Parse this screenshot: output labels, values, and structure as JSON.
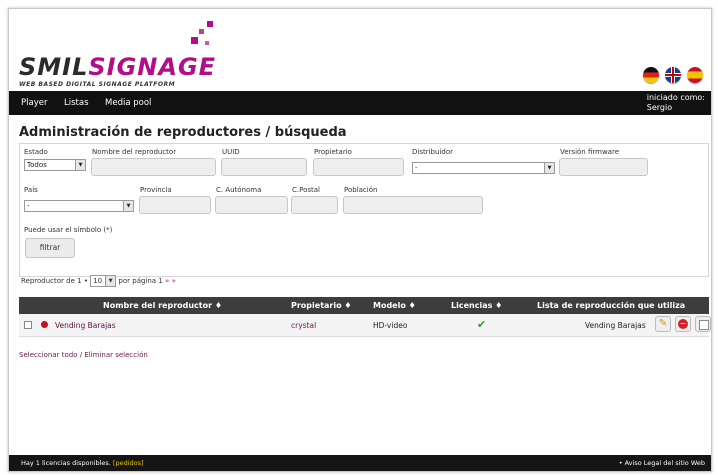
{
  "logo": {
    "word_a": "SMIL",
    "word_b": "SIGNAGE",
    "subtitle": "WEB BASED DIGITAL SIGNAGE PLATFORM",
    "brand_color": "#b10f8a"
  },
  "languages": [
    "Deutsch",
    "English",
    "Español"
  ],
  "nav": {
    "items": [
      "Player",
      "Listas",
      "Media pool"
    ],
    "user_label": "iniciado como:",
    "user_name": "Sergio"
  },
  "page_title": "Administración de reproductores / búsqueda",
  "filters": {
    "estado_label": "Estado",
    "estado_value": "Todos",
    "nombre_label": "Nombre del reproductor",
    "uuid_label": "UUID",
    "propietario_label": "Propietario",
    "distribuidor_label": "Distribuidor",
    "distribuidor_value": "-",
    "version_label": "Versión firmware",
    "pais_label": "País",
    "pais_value": "-",
    "provincia_label": "Provincia",
    "comunidad_label": "C. Autónoma",
    "postal_label": "C.Postal",
    "poblacion_label": "Población",
    "hint": "Puede usar el símbolo (*)",
    "filter_button": "filtrar"
  },
  "pager": {
    "prefix": "Reproductor de 1 •",
    "per_page": "10",
    "suffix": "por página",
    "page": "1",
    "next": "»",
    "last": "»"
  },
  "table": {
    "headers": [
      "Nombre del reproductor ♦",
      "Propietario ♦",
      "Modelo ♦",
      "Licencias ♦",
      "Lista de reproducción que utiliza"
    ],
    "rows": [
      {
        "name": "Vending Barajas",
        "owner": "crystal",
        "model": "HD-video",
        "license": "✔",
        "playlist": "Vending Barajas"
      }
    ]
  },
  "select_all": "Seleccionar todo / Eliminar selección",
  "footer": {
    "licenses": "Hay 1 licencias disponibles.",
    "orders_link": "[pedidos]",
    "legal": "• Aviso Legal del sitio Web"
  }
}
